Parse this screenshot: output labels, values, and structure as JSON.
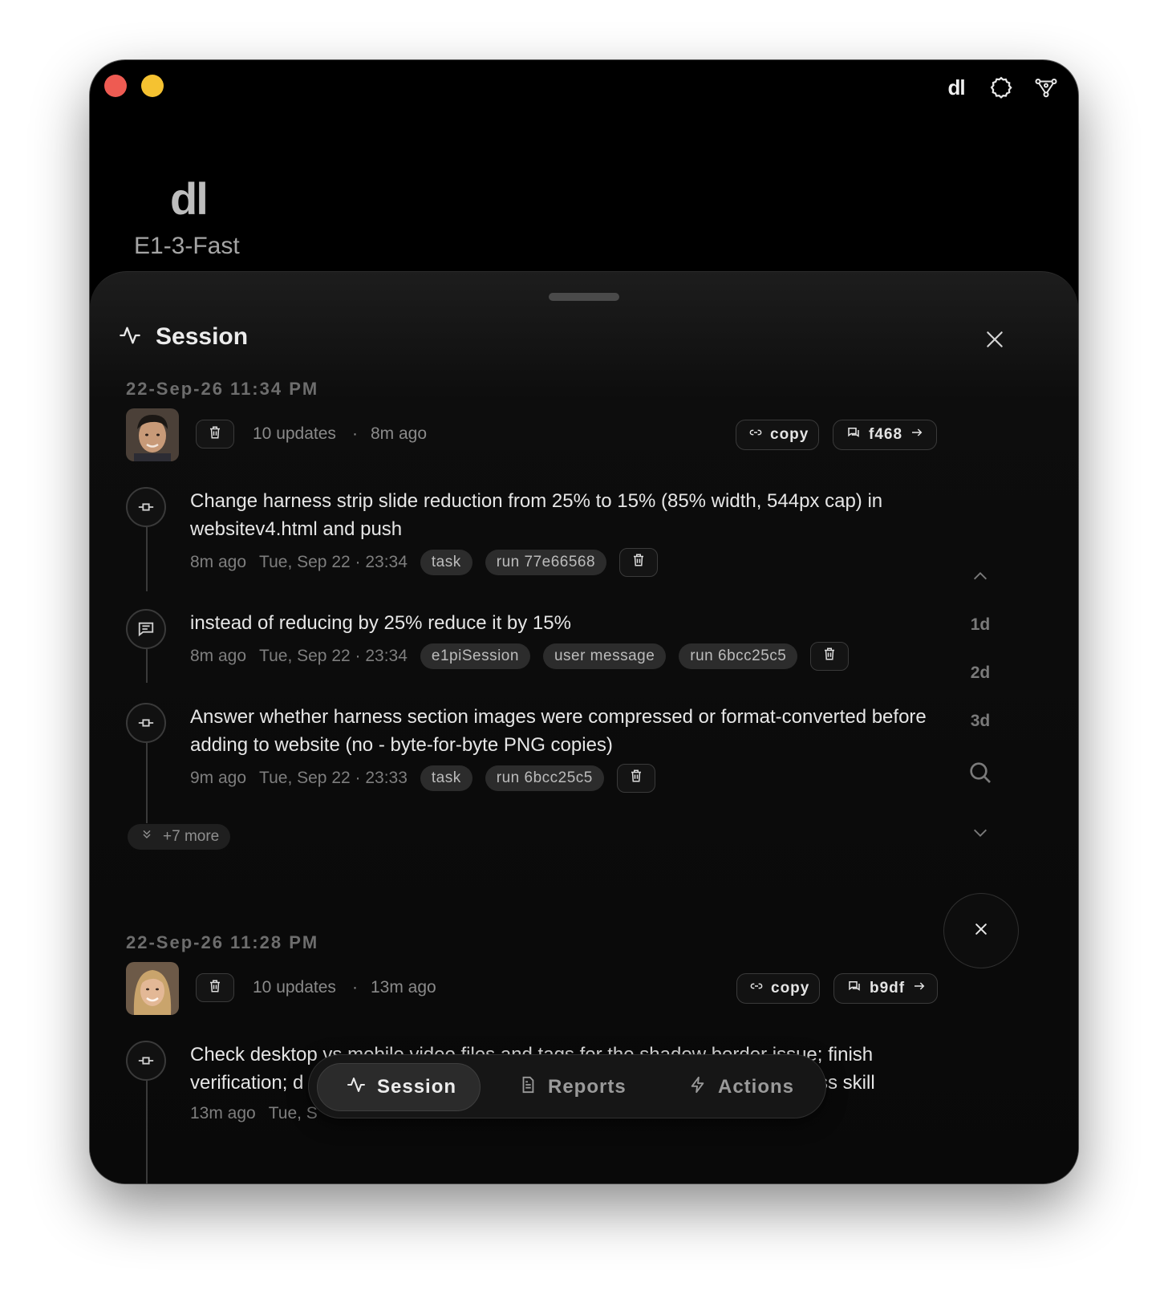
{
  "app": {
    "logo_small": "dl",
    "brand_logo": "dl",
    "brand_name": "E1-3-Fast"
  },
  "sheet": {
    "title": "Session"
  },
  "groups": [
    {
      "date": "22-Sep-26 11:34 PM",
      "updates": "10 updates",
      "ago": "8m ago",
      "copy_label": "copy",
      "link_label": "f468",
      "entries": [
        {
          "text": "Change harness strip slide reduction from 25% to 15% (85% width, 544px cap) in websitev4.html and push",
          "ago": "8m ago",
          "when": "Tue, Sep 22 · 23:34",
          "tags": [
            "task",
            "run 77e66568"
          ]
        },
        {
          "text": "instead of reducing by 25% reduce it by 15%",
          "ago": "8m ago",
          "when": "Tue, Sep 22 · 23:34",
          "tags": [
            "e1piSession",
            "user message",
            "run 6bcc25c5"
          ]
        },
        {
          "text": "Answer whether harness section images were compressed or format-converted before adding to website (no - byte-for-byte PNG copies)",
          "ago": "9m ago",
          "when": "Tue, Sep 22 · 23:33",
          "tags": [
            "task",
            "run 6bcc25c5"
          ]
        }
      ],
      "more_label": "+7 more"
    },
    {
      "date": "22-Sep-26 11:28 PM",
      "updates": "10 updates",
      "ago": "13m ago",
      "copy_label": "copy",
      "link_label": "b9df",
      "entries": [
        {
          "text_line1": "Check desktop vs mobile video files and tags for the shadow border issue; finish",
          "text_line2_left": "verification; d",
          "text_line2_right": "ss skill",
          "ago": "13m ago",
          "when": "Tue, S"
        }
      ]
    }
  ],
  "rail": {
    "d1": "1d",
    "d2": "2d",
    "d3": "3d"
  },
  "bottom_nav": {
    "session": "Session",
    "reports": "Reports",
    "actions": "Actions"
  },
  "meta_separator": "·",
  "icons": [
    "activity-icon",
    "close-icon",
    "trash-icon",
    "link-icon",
    "chat-link-icon",
    "arrow-right-icon",
    "commit-icon",
    "message-icon",
    "chevron-up-icon",
    "chevron-down-icon",
    "search-icon",
    "double-chevron-down-icon",
    "report-icon",
    "bolt-icon",
    "gear-icon",
    "nodes-icon"
  ],
  "colors": {
    "window_bg": "#000000",
    "traffic_red": "#ee5b52",
    "traffic_yellow": "#f5c231",
    "tag_bg": "#2c2c2c"
  }
}
